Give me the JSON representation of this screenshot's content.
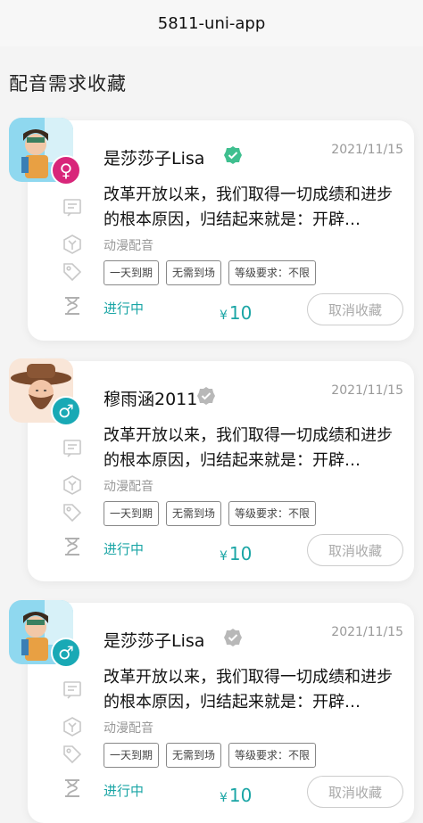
{
  "navbar": {
    "title": "5811-uni-app"
  },
  "page": {
    "title": "配音需求收藏"
  },
  "cards": [
    {
      "name": "是莎莎子Lisa",
      "verified": true,
      "gender": "female",
      "gender_symbol": "♀",
      "date": "2021/11/15",
      "desc": "改革开放以来，我们取得一切成绩和进步的根本原因，归结起来就是：开辟…",
      "category": "动漫配音",
      "tags": [
        "一天到期",
        "无需到场",
        "等级要求：不限"
      ],
      "status": "进行中",
      "currency": "¥",
      "price": "10",
      "cancel_label": "取消收藏"
    },
    {
      "name": "穆雨涵2011",
      "verified": false,
      "gender": "male",
      "gender_symbol": "♂",
      "date": "2021/11/15",
      "desc": "改革开放以来，我们取得一切成绩和进步的根本原因，归结起来就是：开辟…",
      "category": "动漫配音",
      "tags": [
        "一天到期",
        "无需到场",
        "等级要求：不限"
      ],
      "status": "进行中",
      "currency": "¥",
      "price": "10",
      "cancel_label": "取消收藏"
    },
    {
      "name": "是莎莎子Lisa",
      "verified": false,
      "gender": "male",
      "gender_symbol": "♂",
      "date": "2021/11/15",
      "desc": "改革开放以来，我们取得一切成绩和进步的根本原因，归结起来就是：开辟…",
      "category": "动漫配音",
      "tags": [
        "一天到期",
        "无需到场",
        "等级要求：不限"
      ],
      "status": "进行中",
      "currency": "¥",
      "price": "10",
      "cancel_label": "取消收藏"
    }
  ],
  "colors": {
    "accent": "#1aa5a5",
    "female": "#d8267a",
    "male": "#19a9b5",
    "verified": "#3fbf8f",
    "unverified": "#b8b8b8"
  },
  "icons": [
    "message-icon",
    "hexagon-y-icon",
    "tag-icon",
    "hourglass-icon",
    "verified-badge-icon"
  ]
}
